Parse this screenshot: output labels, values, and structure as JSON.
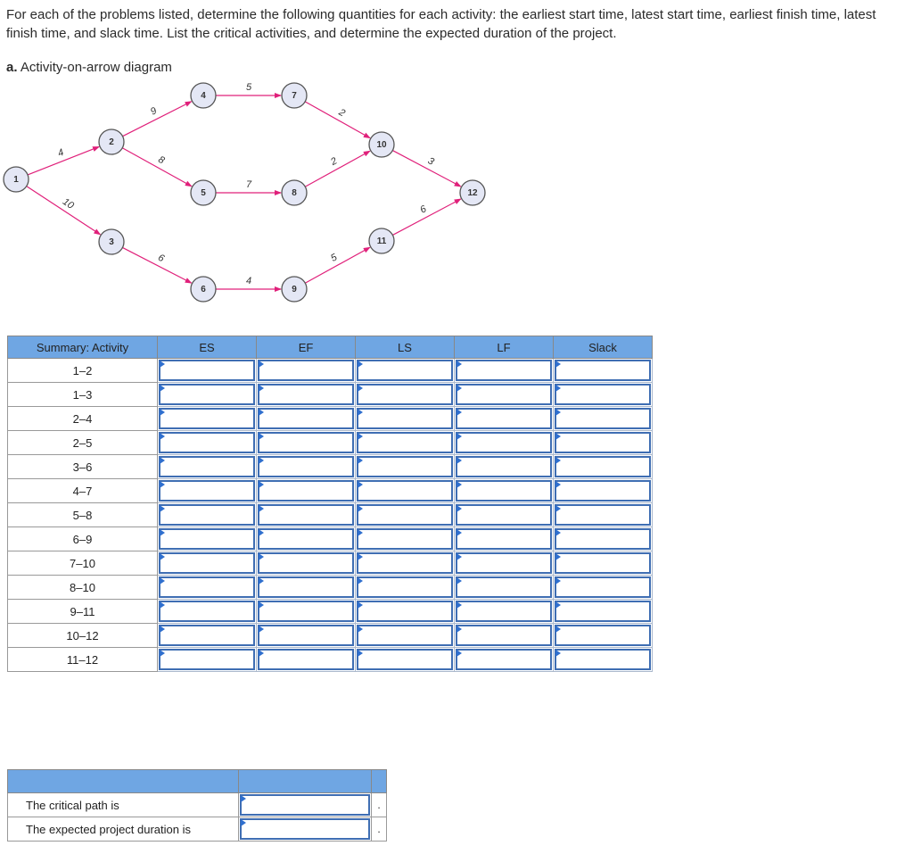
{
  "instructions": "For each of the problems listed, determine the following quantities for each activity: the earliest start time, latest start time, earliest finish time, latest finish time, and slack time. List the critical activities, and determine the expected duration of the project.",
  "part": {
    "letter": "a.",
    "title": "Activity-on-arrow diagram"
  },
  "diagram": {
    "nodes": [
      "1",
      "2",
      "3",
      "4",
      "5",
      "6",
      "7",
      "8",
      "9",
      "10",
      "11",
      "12"
    ],
    "arrows": [
      {
        "from": "1",
        "to": "2",
        "duration": "4"
      },
      {
        "from": "1",
        "to": "3",
        "duration": "10"
      },
      {
        "from": "2",
        "to": "4",
        "duration": "9"
      },
      {
        "from": "2",
        "to": "5",
        "duration": "8"
      },
      {
        "from": "3",
        "to": "6",
        "duration": "6"
      },
      {
        "from": "4",
        "to": "7",
        "duration": "5"
      },
      {
        "from": "5",
        "to": "8",
        "duration": "7"
      },
      {
        "from": "6",
        "to": "9",
        "duration": "4"
      },
      {
        "from": "7",
        "to": "10",
        "duration": "2"
      },
      {
        "from": "8",
        "to": "10",
        "duration": "2"
      },
      {
        "from": "9",
        "to": "11",
        "duration": "5"
      },
      {
        "from": "10",
        "to": "12",
        "duration": "3"
      },
      {
        "from": "11",
        "to": "12",
        "duration": "6"
      }
    ],
    "colors": {
      "arrow": "#e0207a",
      "node_fill": "#e4e7f5",
      "node_stroke": "#555555"
    }
  },
  "table": {
    "headers": [
      "Summary: Activity",
      "ES",
      "EF",
      "LS",
      "LF",
      "Slack"
    ],
    "rows": [
      {
        "activity": "1–2",
        "ES": "",
        "EF": "",
        "LS": "",
        "LF": "",
        "Slack": ""
      },
      {
        "activity": "1–3",
        "ES": "",
        "EF": "",
        "LS": "",
        "LF": "",
        "Slack": ""
      },
      {
        "activity": "2–4",
        "ES": "",
        "EF": "",
        "LS": "",
        "LF": "",
        "Slack": ""
      },
      {
        "activity": "2–5",
        "ES": "",
        "EF": "",
        "LS": "",
        "LF": "",
        "Slack": ""
      },
      {
        "activity": "3–6",
        "ES": "",
        "EF": "",
        "LS": "",
        "LF": "",
        "Slack": ""
      },
      {
        "activity": "4–7",
        "ES": "",
        "EF": "",
        "LS": "",
        "LF": "",
        "Slack": ""
      },
      {
        "activity": "5–8",
        "ES": "",
        "EF": "",
        "LS": "",
        "LF": "",
        "Slack": ""
      },
      {
        "activity": "6–9",
        "ES": "",
        "EF": "",
        "LS": "",
        "LF": "",
        "Slack": ""
      },
      {
        "activity": "7–10",
        "ES": "",
        "EF": "",
        "LS": "",
        "LF": "",
        "Slack": ""
      },
      {
        "activity": "8–10",
        "ES": "",
        "EF": "",
        "LS": "",
        "LF": "",
        "Slack": ""
      },
      {
        "activity": "9–11",
        "ES": "",
        "EF": "",
        "LS": "",
        "LF": "",
        "Slack": ""
      },
      {
        "activity": "10–12",
        "ES": "",
        "EF": "",
        "LS": "",
        "LF": "",
        "Slack": ""
      },
      {
        "activity": "11–12",
        "ES": "",
        "EF": "",
        "LS": "",
        "LF": "",
        "Slack": ""
      }
    ],
    "header_color": "#6fa6e3",
    "input_border_color": "#3f6eb3"
  },
  "summary": {
    "rows": [
      {
        "label": "The critical path is",
        "value": "",
        "suffix": "."
      },
      {
        "label": "The expected project duration is",
        "value": "",
        "suffix": "."
      }
    ]
  }
}
